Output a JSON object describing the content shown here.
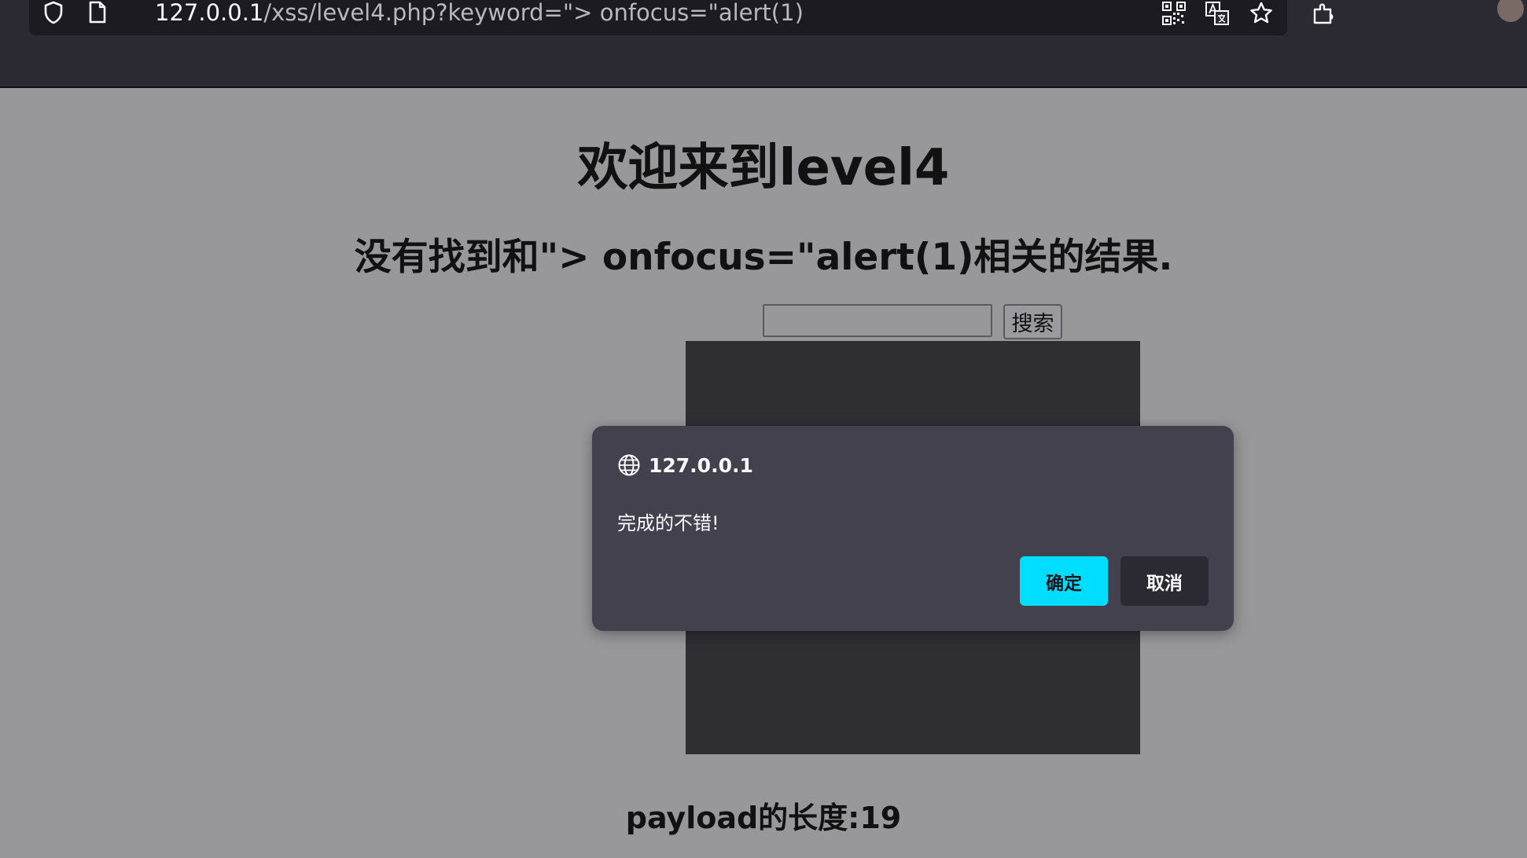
{
  "browser": {
    "url_host": "127.0.0.1",
    "url_rest": "/xss/level4.php?keyword=\"> onfocus=\"alert(1)",
    "icons": [
      "shield-icon",
      "page-icon",
      "qr-code-icon",
      "translate-icon",
      "bookmark-star-icon",
      "extensions-icon",
      "avatar"
    ]
  },
  "page": {
    "title": "欢迎来到level4",
    "result": "没有找到和\"> onfocus=\"alert(1)相关的结果.",
    "search": {
      "value": "",
      "button_label": "搜索"
    },
    "payload_length": "payload的长度:19"
  },
  "dialog": {
    "origin": "127.0.0.1",
    "message": "完成的不错!",
    "ok_label": "确定",
    "cancel_label": "取消",
    "colors": {
      "background": "#42414d",
      "ok": "#00ddff",
      "cancel": "#2b2a33"
    }
  }
}
